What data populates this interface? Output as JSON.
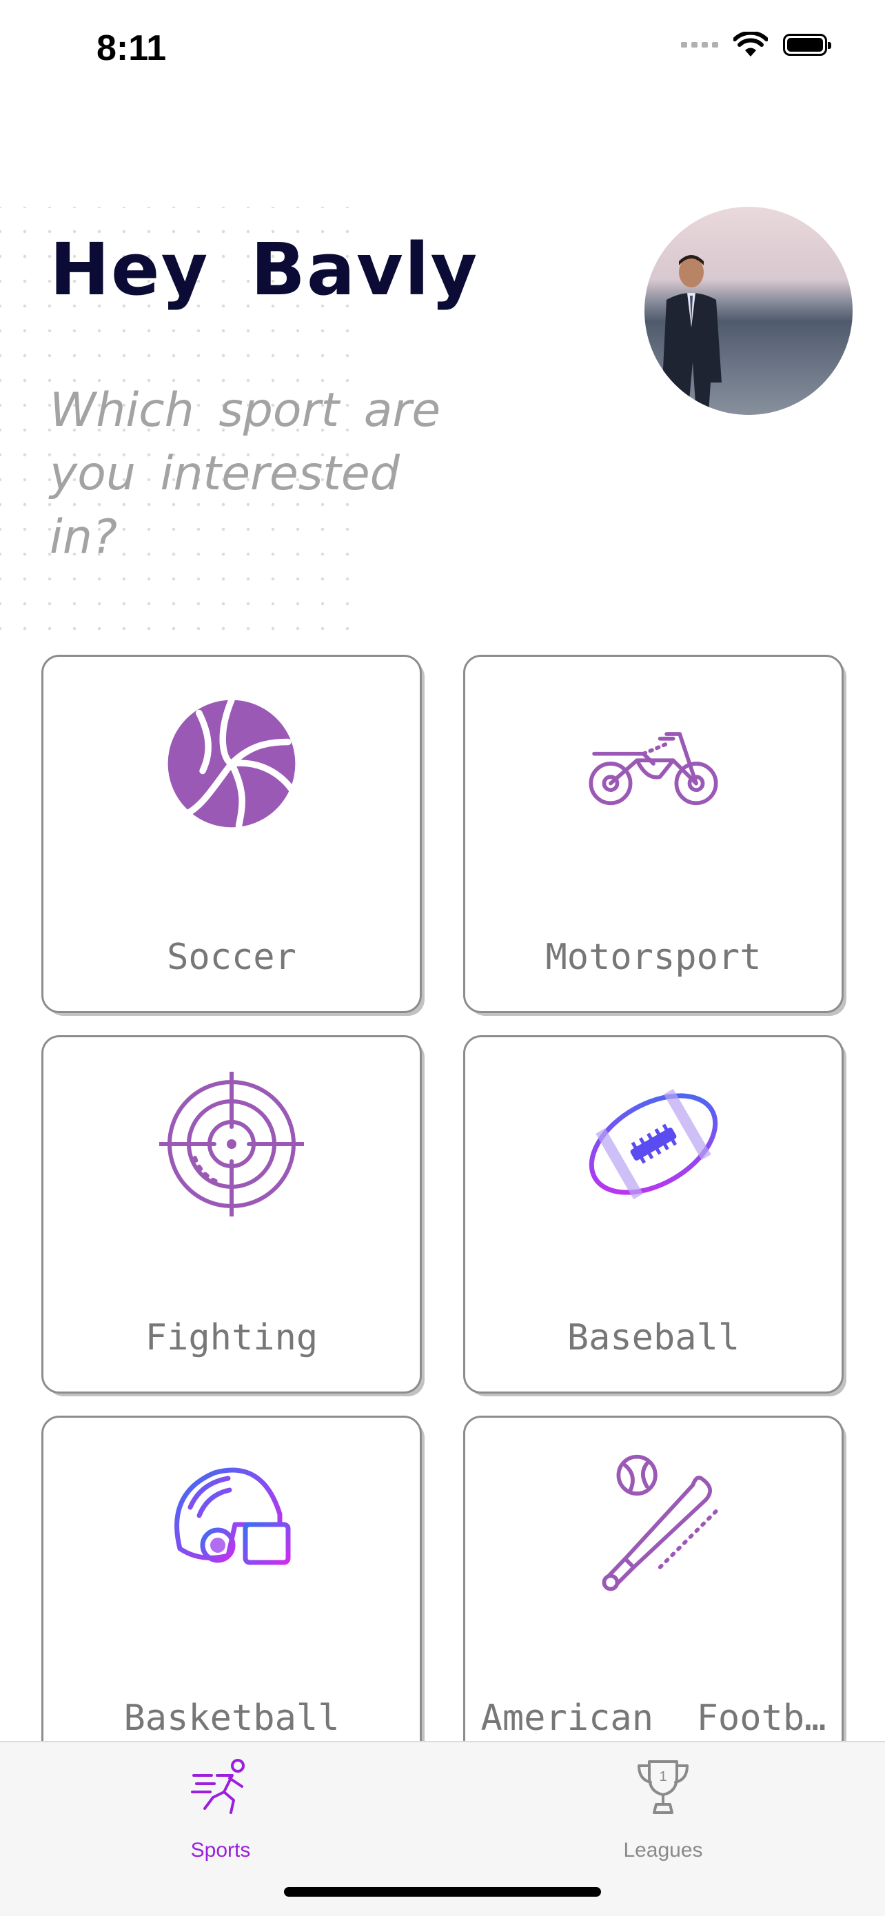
{
  "status_bar": {
    "time": "8:11"
  },
  "header": {
    "greeting": "Hey Bavly",
    "subtitle": "Which sport are you interested in?"
  },
  "sports": [
    {
      "label": "Soccer",
      "icon": "volleyball-icon"
    },
    {
      "label": "Motorsport",
      "icon": "motorbike-icon"
    },
    {
      "label": "Fighting",
      "icon": "crosshair-icon"
    },
    {
      "label": "Baseball",
      "icon": "football-icon"
    },
    {
      "label": "Basketball",
      "icon": "helmet-icon"
    },
    {
      "label": "American  Footb…",
      "icon": "baseball-bat-icon"
    }
  ],
  "tab_bar": {
    "tabs": [
      {
        "label": "Sports",
        "icon": "runner-icon",
        "selected": true
      },
      {
        "label": "Leagues",
        "icon": "trophy-icon",
        "selected": false
      }
    ]
  },
  "colors": {
    "accent": "#9b1fdc",
    "icon_purple": "#9b59b6",
    "title": "#0b0b35",
    "subtitle": "#a3a3a3"
  }
}
